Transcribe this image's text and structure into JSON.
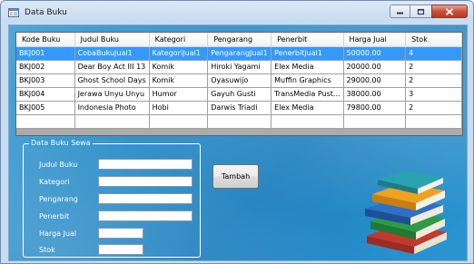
{
  "window": {
    "title": "Data Buku",
    "icon": "form-icon",
    "controls": {
      "minimize": "minimize-icon",
      "maximize": "maximize-icon",
      "close": "close-icon"
    }
  },
  "grid": {
    "columns": [
      "Kode Buku",
      "Judul Buku",
      "Kategori",
      "Pengarang",
      "Penerbit",
      "Harga Jual",
      "Stok"
    ],
    "rows": [
      [
        "BKJ001",
        "CobaBukuJual1",
        "KategoriJual1",
        "PengarangJual1",
        "PenerbitJual1",
        "50000.00",
        "4"
      ],
      [
        "BKJ002",
        "Dear Boy Act III 13",
        "Komik",
        "Hiroki Yagami",
        "Elex Media",
        "20000.00",
        "2"
      ],
      [
        "BKJ003",
        "Ghost School Days",
        "Komik",
        "Oyasuwijo",
        "Muffin Graphics",
        "29000.00",
        "2"
      ],
      [
        "BKJ004",
        "Jerawa Unyu Unyu",
        "Humor",
        "Gayuh Gusti",
        "TransMedia Pust...",
        "38000.00",
        "3"
      ],
      [
        "BKJ005",
        "Indonesia Photo",
        "Hobi",
        "Darwis Triadi",
        "Elex Media",
        "79800.00",
        "2"
      ]
    ],
    "selected_row": 0
  },
  "form": {
    "group_title": "Data Buku Sewa",
    "labels": {
      "judul": "Judul Buku",
      "kategori": "Kategori",
      "pengarang": "Pengarang",
      "penerbit": "Penerbit",
      "harga": "Harga Jual",
      "stok": "Stok"
    },
    "values": {
      "judul": "",
      "kategori": "",
      "pengarang": "",
      "penerbit": "",
      "harga": "",
      "stok": ""
    }
  },
  "actions": {
    "tambah": "Tambah"
  },
  "decoration": {
    "image": "books-stack-icon"
  }
}
